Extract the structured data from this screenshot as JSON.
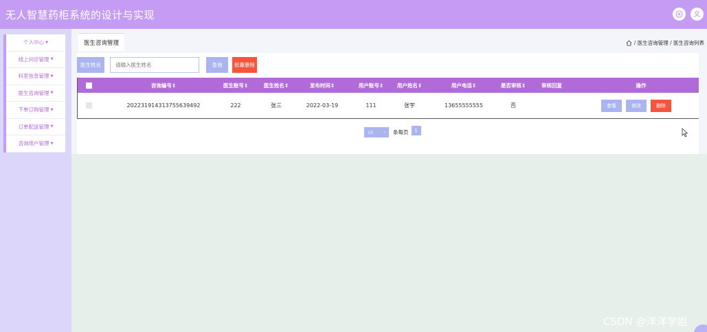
{
  "header": {
    "title": "无人智慧药柜系统的设计与实现",
    "icons": [
      "close-circle-icon",
      "user-icon"
    ]
  },
  "sidebar": {
    "items": [
      {
        "label": "个人中心"
      },
      {
        "label": "线上问诊管理"
      },
      {
        "label": "科室信息管理"
      },
      {
        "label": "医生咨询管理"
      },
      {
        "label": "下单订购管理"
      },
      {
        "label": "订单配送管理"
      },
      {
        "label": "咨询用户管理"
      }
    ]
  },
  "tabbar": {
    "active_tab": "医生咨询管理",
    "breadcrumb": "/ 医生咨询管理 / 医生咨询列表"
  },
  "search": {
    "label": "医生姓名",
    "placeholder": "请输入医生姓名",
    "search_btn": "查询",
    "batch_delete_btn": "批量删除"
  },
  "table": {
    "columns": [
      "咨询编号",
      "医生账号",
      "医生姓名",
      "发布时间",
      "用户账号",
      "用户姓名",
      "用户电话",
      "是否审核",
      "审核回复",
      "操作"
    ],
    "rows": [
      {
        "consult_no": "20223191431375563949​2",
        "doctor_account": "222",
        "doctor_name": "张三",
        "publish_time": "2022-03-19",
        "user_account": "111",
        "user_name": "张宇",
        "user_phone": "13655555555",
        "reviewed": "否",
        "review_reply": "",
        "actions": {
          "view": "查看",
          "edit": "修改",
          "delete": "删除"
        }
      }
    ]
  },
  "pager": {
    "page_size": "10",
    "per_page_label": "条每页",
    "current_page": "1"
  },
  "watermark": "CSDN @洋洋学姐",
  "colors": {
    "header": "#c49cf4",
    "table_header": "#b16bd8",
    "primary_button": "#a9b4f0",
    "danger_button": "#f7543d",
    "sidebar_bg": "#dcd6fa",
    "content_bg": "#e6efe9"
  }
}
